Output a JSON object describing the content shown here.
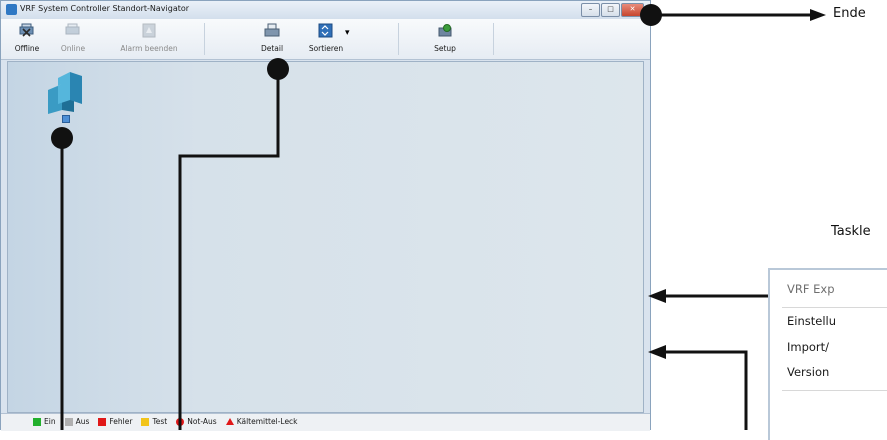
{
  "window": {
    "title": "VRF System Controller Standort-Navigator",
    "controls": {
      "minimize": "–",
      "maximize": "□",
      "close": "✕"
    }
  },
  "toolbar": {
    "offline": "Offline",
    "online": "Online",
    "alarm_end": "Alarm beenden",
    "detail": "Detail",
    "sort": "Sortieren",
    "setup": "Setup"
  },
  "legend": [
    {
      "label": "Ein",
      "color": "#22b02c"
    },
    {
      "label": "Aus",
      "color": "#b0b0b0"
    },
    {
      "label": "Fehler",
      "color": "#e01818"
    },
    {
      "label": "Test",
      "color": "#f2c41a"
    },
    {
      "label": "Not-Aus",
      "color": "#e01818"
    },
    {
      "label": "Kältemittel-Leck",
      "color": "#e01818"
    }
  ],
  "callouts": {
    "end": "Ende",
    "tasklist": "Taskle"
  },
  "task_menu": {
    "header": "VRF Exp",
    "items": [
      "Einstellu",
      "Import/",
      "Version"
    ]
  },
  "colors": {
    "accent": "#2f78c4",
    "window_bg": "#d9e3ee"
  }
}
